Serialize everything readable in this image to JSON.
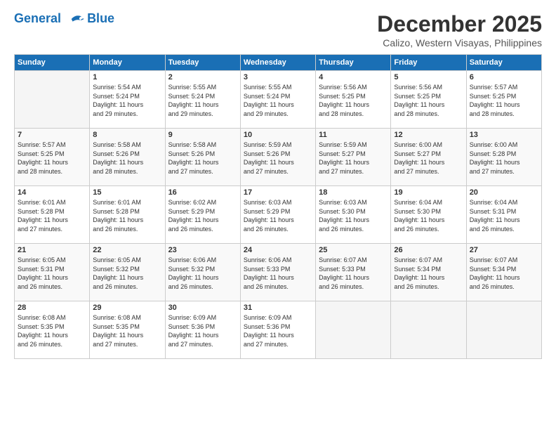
{
  "logo": {
    "line1": "General",
    "line2": "Blue"
  },
  "title": "December 2025",
  "subtitle": "Calizo, Western Visayas, Philippines",
  "weekdays": [
    "Sunday",
    "Monday",
    "Tuesday",
    "Wednesday",
    "Thursday",
    "Friday",
    "Saturday"
  ],
  "weeks": [
    [
      {
        "day": "",
        "info": ""
      },
      {
        "day": "1",
        "info": "Sunrise: 5:54 AM\nSunset: 5:24 PM\nDaylight: 11 hours\nand 29 minutes."
      },
      {
        "day": "2",
        "info": "Sunrise: 5:55 AM\nSunset: 5:24 PM\nDaylight: 11 hours\nand 29 minutes."
      },
      {
        "day": "3",
        "info": "Sunrise: 5:55 AM\nSunset: 5:24 PM\nDaylight: 11 hours\nand 29 minutes."
      },
      {
        "day": "4",
        "info": "Sunrise: 5:56 AM\nSunset: 5:25 PM\nDaylight: 11 hours\nand 28 minutes."
      },
      {
        "day": "5",
        "info": "Sunrise: 5:56 AM\nSunset: 5:25 PM\nDaylight: 11 hours\nand 28 minutes."
      },
      {
        "day": "6",
        "info": "Sunrise: 5:57 AM\nSunset: 5:25 PM\nDaylight: 11 hours\nand 28 minutes."
      }
    ],
    [
      {
        "day": "7",
        "info": "Sunrise: 5:57 AM\nSunset: 5:25 PM\nDaylight: 11 hours\nand 28 minutes."
      },
      {
        "day": "8",
        "info": "Sunrise: 5:58 AM\nSunset: 5:26 PM\nDaylight: 11 hours\nand 28 minutes."
      },
      {
        "day": "9",
        "info": "Sunrise: 5:58 AM\nSunset: 5:26 PM\nDaylight: 11 hours\nand 27 minutes."
      },
      {
        "day": "10",
        "info": "Sunrise: 5:59 AM\nSunset: 5:26 PM\nDaylight: 11 hours\nand 27 minutes."
      },
      {
        "day": "11",
        "info": "Sunrise: 5:59 AM\nSunset: 5:27 PM\nDaylight: 11 hours\nand 27 minutes."
      },
      {
        "day": "12",
        "info": "Sunrise: 6:00 AM\nSunset: 5:27 PM\nDaylight: 11 hours\nand 27 minutes."
      },
      {
        "day": "13",
        "info": "Sunrise: 6:00 AM\nSunset: 5:28 PM\nDaylight: 11 hours\nand 27 minutes."
      }
    ],
    [
      {
        "day": "14",
        "info": "Sunrise: 6:01 AM\nSunset: 5:28 PM\nDaylight: 11 hours\nand 27 minutes."
      },
      {
        "day": "15",
        "info": "Sunrise: 6:01 AM\nSunset: 5:28 PM\nDaylight: 11 hours\nand 26 minutes."
      },
      {
        "day": "16",
        "info": "Sunrise: 6:02 AM\nSunset: 5:29 PM\nDaylight: 11 hours\nand 26 minutes."
      },
      {
        "day": "17",
        "info": "Sunrise: 6:03 AM\nSunset: 5:29 PM\nDaylight: 11 hours\nand 26 minutes."
      },
      {
        "day": "18",
        "info": "Sunrise: 6:03 AM\nSunset: 5:30 PM\nDaylight: 11 hours\nand 26 minutes."
      },
      {
        "day": "19",
        "info": "Sunrise: 6:04 AM\nSunset: 5:30 PM\nDaylight: 11 hours\nand 26 minutes."
      },
      {
        "day": "20",
        "info": "Sunrise: 6:04 AM\nSunset: 5:31 PM\nDaylight: 11 hours\nand 26 minutes."
      }
    ],
    [
      {
        "day": "21",
        "info": "Sunrise: 6:05 AM\nSunset: 5:31 PM\nDaylight: 11 hours\nand 26 minutes."
      },
      {
        "day": "22",
        "info": "Sunrise: 6:05 AM\nSunset: 5:32 PM\nDaylight: 11 hours\nand 26 minutes."
      },
      {
        "day": "23",
        "info": "Sunrise: 6:06 AM\nSunset: 5:32 PM\nDaylight: 11 hours\nand 26 minutes."
      },
      {
        "day": "24",
        "info": "Sunrise: 6:06 AM\nSunset: 5:33 PM\nDaylight: 11 hours\nand 26 minutes."
      },
      {
        "day": "25",
        "info": "Sunrise: 6:07 AM\nSunset: 5:33 PM\nDaylight: 11 hours\nand 26 minutes."
      },
      {
        "day": "26",
        "info": "Sunrise: 6:07 AM\nSunset: 5:34 PM\nDaylight: 11 hours\nand 26 minutes."
      },
      {
        "day": "27",
        "info": "Sunrise: 6:07 AM\nSunset: 5:34 PM\nDaylight: 11 hours\nand 26 minutes."
      }
    ],
    [
      {
        "day": "28",
        "info": "Sunrise: 6:08 AM\nSunset: 5:35 PM\nDaylight: 11 hours\nand 26 minutes."
      },
      {
        "day": "29",
        "info": "Sunrise: 6:08 AM\nSunset: 5:35 PM\nDaylight: 11 hours\nand 27 minutes."
      },
      {
        "day": "30",
        "info": "Sunrise: 6:09 AM\nSunset: 5:36 PM\nDaylight: 11 hours\nand 27 minutes."
      },
      {
        "day": "31",
        "info": "Sunrise: 6:09 AM\nSunset: 5:36 PM\nDaylight: 11 hours\nand 27 minutes."
      },
      {
        "day": "",
        "info": ""
      },
      {
        "day": "",
        "info": ""
      },
      {
        "day": "",
        "info": ""
      }
    ]
  ]
}
